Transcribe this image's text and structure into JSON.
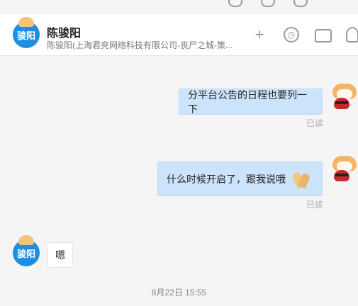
{
  "contact": {
    "name": "陈骏阳",
    "subtitle": "陈骏阳(上海君亮网络科技有限公司-丧尸之城-策...",
    "avatar_text": "骏阳"
  },
  "toolbar": {
    "add": "+",
    "history_icon": "clock-icon",
    "folder_icon": "folder-icon",
    "profile_icon": "user-icon"
  },
  "messages": [
    {
      "side": "me",
      "text": "分平台公告的日程也要列一下",
      "status": "已读"
    },
    {
      "side": "me",
      "text": "什么时候开启了，跟我说哦",
      "status": "已读",
      "emoji": "praying-hands"
    },
    {
      "side": "them",
      "text": "嗯",
      "avatar_text": "骏阳"
    }
  ],
  "timestamp": "8月22日 15:55"
}
